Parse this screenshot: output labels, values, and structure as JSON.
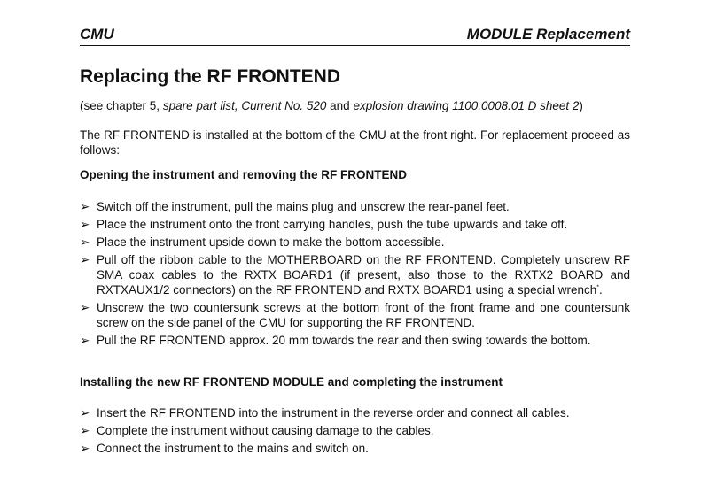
{
  "header": {
    "left": "CMU",
    "right": "MODULE Replacement"
  },
  "title": "Replacing the RF FRONTEND",
  "reference": {
    "prefix": "(see chapter 5, ",
    "spare_list": "spare part list, Current No. 520",
    "and": " and ",
    "drawing": "explosion drawing 1100.0008.01 D sheet 2",
    "suffix": ")"
  },
  "intro": "The RF FRONTEND is installed at the bottom of the CMU at the front right. For replacement proceed as follows:",
  "sections": [
    {
      "heading": "Opening the instrument and removing the RF FRONTEND",
      "steps": [
        "Switch off the instrument, pull the mains plug and unscrew the rear-panel feet.",
        "Place the instrument onto the front carrying handles, push the tube upwards and take off.",
        "Place the instrument upside down to make the bottom accessible.",
        "Pull off the ribbon cable to the MOTHERBOARD on the RF FRONTEND. Completely unscrew RF SMA coax cables to the RXTX BOARD1 (if present, also those to the RXTX2 BOARD and RXTXAUX1/2 connectors) on the RF FRONTEND and RXTX BOARD1 using a special wrench",
        "Unscrew the two countersunk screws at the bottom front of the front frame and one countersunk screw on the side panel of the CMU for supporting the RF FRONTEND.",
        "Pull the RF FRONTEND approx. 20 mm towards the rear and then swing towards the bottom."
      ],
      "step4_footnote_mark": "*",
      "step4_end": "."
    },
    {
      "heading": "Installing the new RF FRONTEND MODULE and completing the instrument",
      "steps": [
        "Insert the RF FRONTEND into the instrument in the reverse order and connect all cables.",
        "Complete the instrument without causing damage to the cables.",
        "Connect the instrument to the mains and switch on."
      ]
    }
  ],
  "bullet_glyph": "➢"
}
